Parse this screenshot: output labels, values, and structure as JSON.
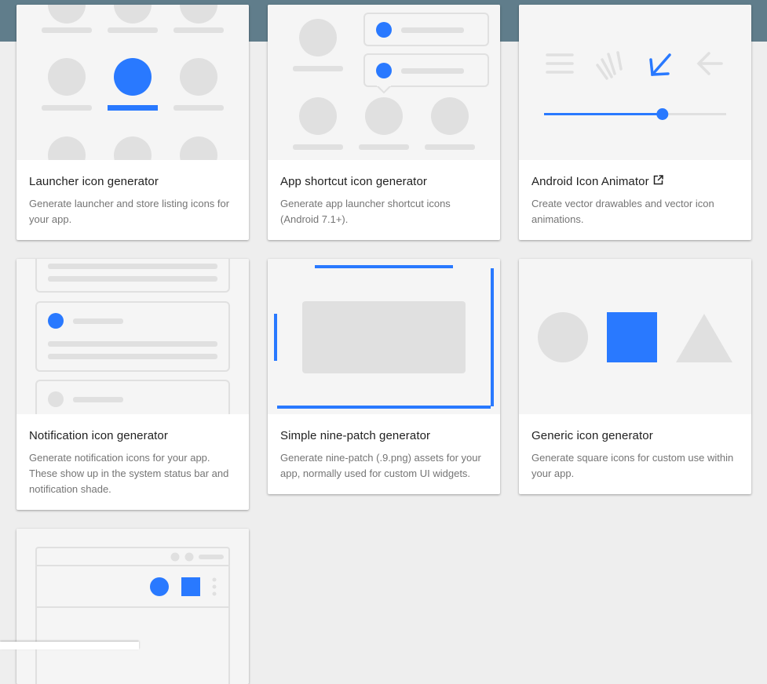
{
  "colors": {
    "accent": "#2979ff",
    "placeholder": "#e0e0e0",
    "art_bg": "#f5f5f5",
    "header": "#607d8b"
  },
  "cards": [
    {
      "title": "Launcher icon generator",
      "description": "Generate launcher and store listing icons for your app."
    },
    {
      "title": "App shortcut icon generator",
      "description": "Generate app launcher shortcut icons (Android 7.1+)."
    },
    {
      "title": "Android Icon Animator",
      "description": "Create vector drawables and vector icon animations.",
      "icon": "open-in-new-icon"
    },
    {
      "title": "Notification icon generator",
      "description": "Generate notification icons for your app. These show up in the system status bar and notification shade."
    },
    {
      "title": "Simple nine-patch generator",
      "description": "Generate nine-patch (.9.png) assets for your app, normally used for custom UI widgets."
    },
    {
      "title": "Generic icon generator",
      "description": "Generate square icons for custom use within your app."
    }
  ],
  "icon_animator_slider": {
    "value": 0.65
  }
}
